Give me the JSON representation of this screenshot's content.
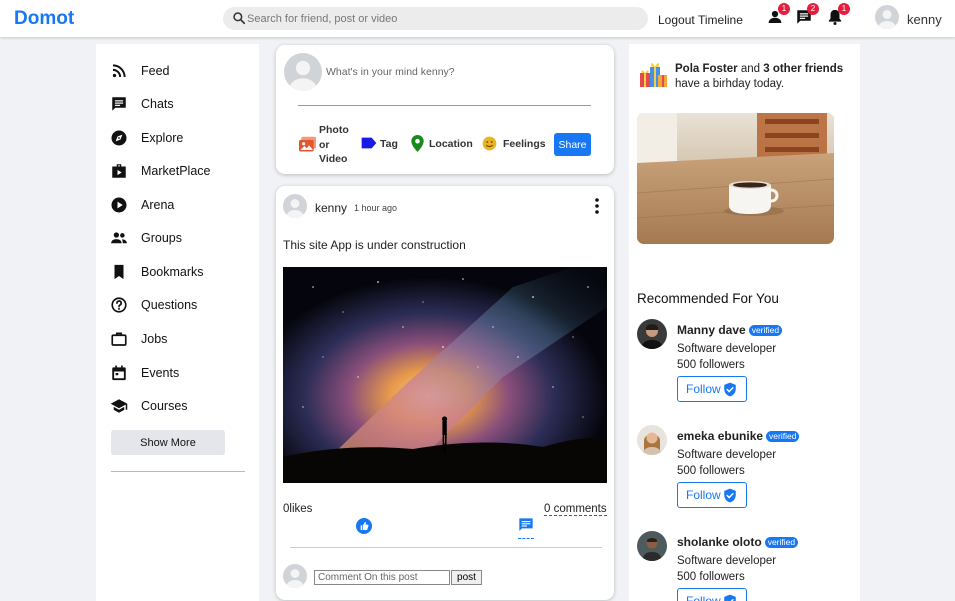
{
  "brand": {
    "logo": "Domot",
    "accent": "#1877f2",
    "badge_color": "#e41e3f"
  },
  "search": {
    "placeholder": "Search for friend, post or video"
  },
  "topbar": {
    "links": [
      "Logout",
      "Timeline"
    ],
    "icons": [
      {
        "name": "friend-requests-icon",
        "badge": "1"
      },
      {
        "name": "messages-icon",
        "badge": "2"
      },
      {
        "name": "notifications-icon",
        "badge": "1"
      }
    ],
    "username": "kenny"
  },
  "sidebar": {
    "items": [
      {
        "icon": "rss-feed-icon",
        "label": "Feed"
      },
      {
        "icon": "chat-icon",
        "label": "Chats"
      },
      {
        "icon": "explore-icon",
        "label": "Explore"
      },
      {
        "icon": "marketplace-icon",
        "label": "MarketPlace"
      },
      {
        "icon": "play-circle-icon",
        "label": "Arena"
      },
      {
        "icon": "groups-icon",
        "label": "Groups"
      },
      {
        "icon": "bookmark-icon",
        "label": "Bookmarks"
      },
      {
        "icon": "help-circle-icon",
        "label": "Questions"
      },
      {
        "icon": "briefcase-icon",
        "label": "Jobs"
      },
      {
        "icon": "calendar-icon",
        "label": "Events"
      },
      {
        "icon": "school-icon",
        "label": "Courses"
      }
    ],
    "show_more": "Show More"
  },
  "share": {
    "placeholder": "What's in your mind kenny?",
    "options": [
      {
        "icon": "photo-icon",
        "label_lines": [
          "Photo",
          "or",
          "Video"
        ],
        "color": "#e4572e"
      },
      {
        "icon": "tag-icon",
        "label": "Tag",
        "color": "#1a1ae6"
      },
      {
        "icon": "location-icon",
        "label": "Location",
        "color": "#1b8a1b"
      },
      {
        "icon": "feelings-icon",
        "label": "Feelings",
        "color": "#e8b525"
      }
    ],
    "share_button": "Share"
  },
  "post": {
    "user": "kenny",
    "time": "1 hour ago",
    "text": "This site App is under construction",
    "likes": "0likes",
    "comments": "0 comments",
    "comment_placeholder": "Comment On this post",
    "comment_button": "post"
  },
  "birthday": {
    "name": "Pola Foster",
    "and": "and",
    "others": "3 other friends",
    "rest": "have a birhday today."
  },
  "recommended": {
    "title": "Recommended For You",
    "verified_label": "verified",
    "follow_label": "Follow",
    "people": [
      {
        "name": "Manny dave",
        "job": "Software developer",
        "followers": "500 followers"
      },
      {
        "name": "emeka ebunike",
        "job": "Software developer",
        "followers": "500 followers"
      },
      {
        "name": "sholanke oloto",
        "job": "Software developer",
        "followers": "500 followers"
      }
    ]
  }
}
